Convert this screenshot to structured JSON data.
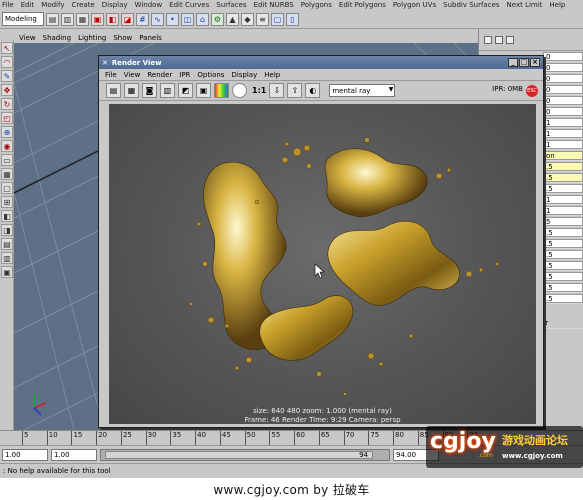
{
  "menubar": {
    "items": [
      "File",
      "Edit",
      "Modify",
      "Create",
      "Display",
      "Window",
      "Edit Curves",
      "Surfaces",
      "Edit NURBS",
      "Polygons",
      "Edit Polygons",
      "Polygon UVs",
      "Subdiv Surfaces",
      "Next Limit",
      "Help"
    ]
  },
  "statusline": {
    "mode": "Modeling"
  },
  "panel": {
    "menu": [
      "View",
      "Shading",
      "Lighting",
      "Show",
      "Panels"
    ]
  },
  "channelbox": {
    "values": [
      "0",
      "0",
      "0",
      "0",
      "0",
      "0",
      "1",
      "1",
      "1",
      "on",
      ".5",
      ".5",
      ".5",
      "1",
      "1",
      "5",
      ".5",
      ".5",
      ".5",
      ".5",
      ".5",
      ".5",
      ".5"
    ],
    "truncated_labels": [
      "er"
    ]
  },
  "timeline": {
    "ticks": [
      "5",
      "10",
      "15",
      "20",
      "25",
      "30",
      "35",
      "40",
      "45",
      "50",
      "55",
      "60",
      "65",
      "70",
      "75",
      "80",
      "85",
      "90",
      "95"
    ]
  },
  "range": {
    "start": "1.00",
    "current": "1.00",
    "thumb_value": "94",
    "end": "94.00"
  },
  "helpline": {
    "text": ": No help available for this tool"
  },
  "renderview": {
    "title": "Render View",
    "menu": [
      "File",
      "View",
      "Render",
      "IPR",
      "Options",
      "Display",
      "Help"
    ],
    "ratio": "1:1",
    "renderer": "mental ray",
    "ipr": "IPR: 0MB",
    "info_line1": "size:  640  480  zoom: 1.000         (mental ray)",
    "info_line2": "Frame: 46      Render Time: 9:29        Camera: persp"
  },
  "watermark": {
    "logo": "cgjoy",
    "dotcom": ".com",
    "chinese": "游戏动画论坛",
    "url": "www.cgjoy.com"
  },
  "footer": {
    "caption": "www.cgjoy.com by 拉破车"
  },
  "colors": {
    "viewport_bg": "#5e7086",
    "render_bg": "#555555",
    "title_bar": "#5b7399",
    "liquid_gold": "#c9a227"
  }
}
